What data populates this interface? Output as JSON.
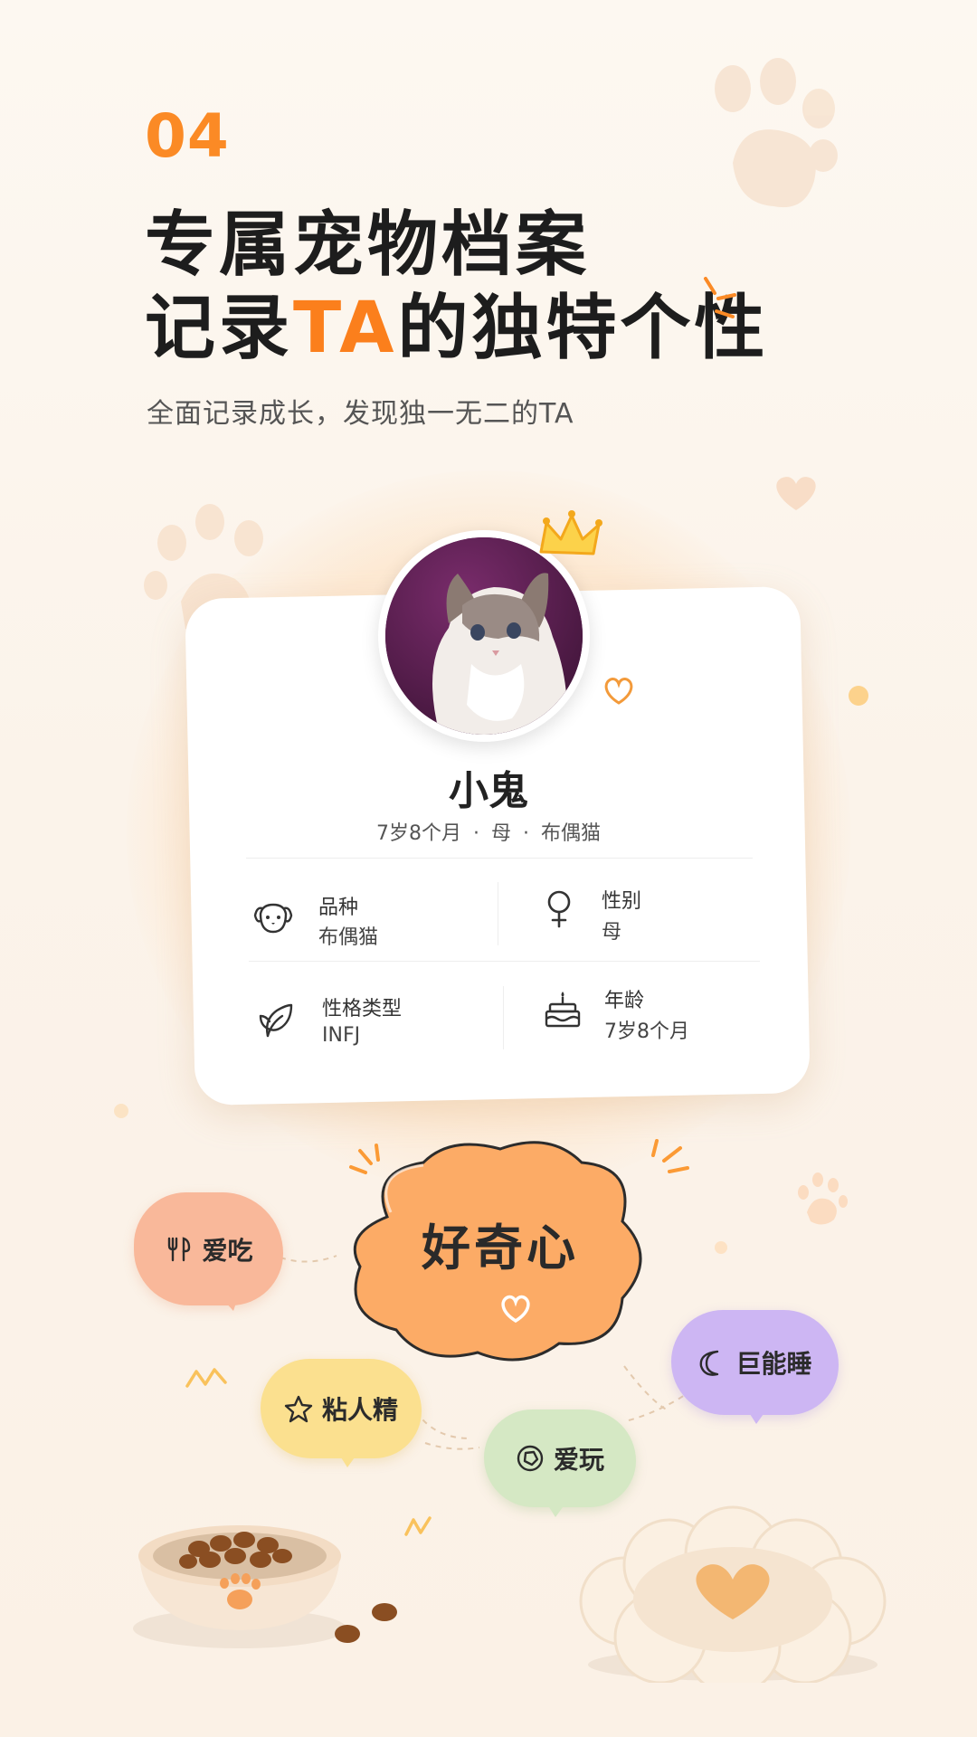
{
  "step_number": "04",
  "headline": {
    "line1": "专属宠物档案",
    "line2_prefix": "记录",
    "line2_highlight": "TA",
    "line2_suffix": "的独特个性"
  },
  "subtitle": "全面记录成长，发现独一无二的TA",
  "profile": {
    "name": "小鬼",
    "summary_age": "7岁8个月",
    "summary_sep": "·",
    "summary_gender": "母",
    "summary_breed": "布偶猫",
    "fields": [
      {
        "label": "品种",
        "value": "布偶猫",
        "icon": "dog-face-icon"
      },
      {
        "label": "性别",
        "value": "母",
        "icon": "female-symbol-icon"
      },
      {
        "label": "性格类型",
        "value": "INFJ",
        "icon": "leaf-icon"
      },
      {
        "label": "年龄",
        "value": "7岁8个月",
        "icon": "birthday-cake-icon"
      }
    ]
  },
  "traits": {
    "main": "好奇心",
    "tags": [
      {
        "label": "爱吃",
        "icon": "utensils-icon",
        "color": "#f9b89a"
      },
      {
        "label": "粘人精",
        "icon": "star-icon",
        "color": "#fbe08f"
      },
      {
        "label": "爱玩",
        "icon": "ball-icon",
        "color": "#d5e8c4"
      },
      {
        "label": "巨能睡",
        "icon": "moon-icon",
        "color": "#cdb6f3"
      }
    ]
  },
  "colors": {
    "accent": "#fb8a25",
    "main_bubble": "#fcab66",
    "background": "#fdf8f1"
  }
}
